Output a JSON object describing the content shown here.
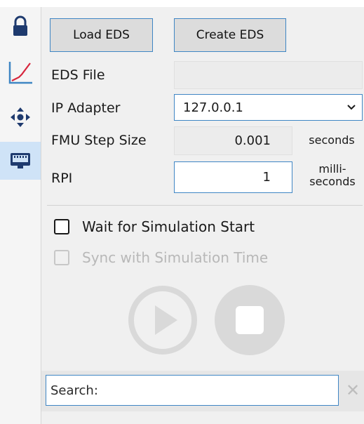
{
  "sidebar": {
    "items": [
      {
        "icon": "lock-icon"
      },
      {
        "icon": "chart-icon"
      },
      {
        "icon": "move-icon"
      },
      {
        "icon": "ethernet-port-icon",
        "active": true
      }
    ]
  },
  "toolbar": {
    "load_label": "Load EDS",
    "create_label": "Create EDS"
  },
  "form": {
    "eds_file": {
      "label": "EDS File",
      "value": ""
    },
    "ip_adapter": {
      "label": "IP Adapter",
      "value": "127.0.0.1"
    },
    "fmu_step": {
      "label": "FMU Step Size",
      "value": "0.001",
      "unit": "seconds"
    },
    "rpi": {
      "label": "RPI",
      "value": "1",
      "unit_line1": "milli-",
      "unit_line2": "seconds"
    }
  },
  "options": {
    "wait_label": "Wait for Simulation Start",
    "wait_checked": false,
    "sync_label": "Sync with Simulation Time",
    "sync_checked": false,
    "sync_disabled": true
  },
  "controls": {
    "play_icon": "play-icon",
    "stop_icon": "stop-icon"
  },
  "search": {
    "value": "Search:",
    "clear_glyph": "✕"
  },
  "colors": {
    "accent": "#3f86c4",
    "active_rail": "#cfe3f7",
    "disabled_control": "#d9d9d9"
  }
}
